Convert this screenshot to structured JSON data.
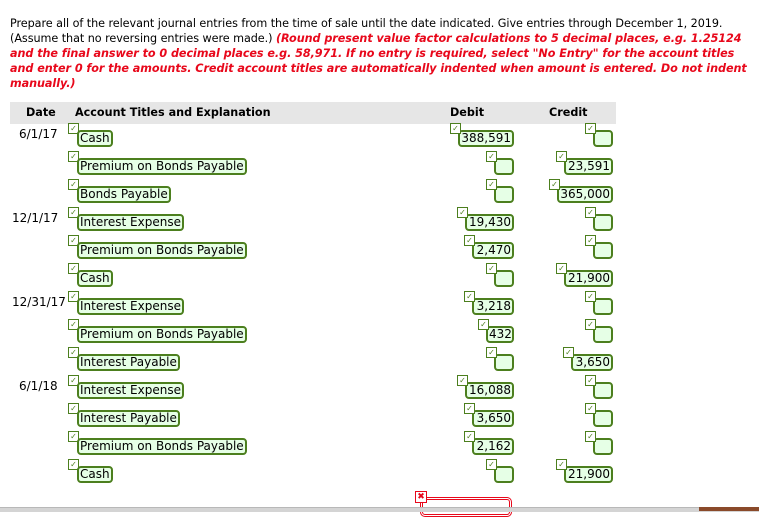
{
  "instructions": {
    "plain": "Prepare all of the relevant journal entries from the time of sale until the date indicated. Give entries through December 1, 2019. (Assume that no reversing entries were made.) ",
    "emphasis": "(Round present value factor calculations to 5 decimal places, e.g. 1.25124 and the final answer to 0 decimal places e.g. 58,971. If no entry is required, select \"No Entry\" for the account titles and enter 0 for the amounts. Credit account titles are automatically indented when amount is entered. Do not indent manually.)"
  },
  "table": {
    "headers": {
      "date": "Date",
      "account": "Account Titles and Explanation",
      "debit": "Debit",
      "credit": "Credit"
    },
    "rows": [
      {
        "date": "6/1/17",
        "account": "Cash",
        "debit": "388,591",
        "credit": ""
      },
      {
        "date": "",
        "account": "Premium on Bonds Payable",
        "debit": "",
        "credit": "23,591"
      },
      {
        "date": "",
        "account": "Bonds Payable",
        "debit": "",
        "credit": "365,000"
      },
      {
        "date": "12/1/17",
        "account": "Interest Expense",
        "debit": "19,430",
        "credit": ""
      },
      {
        "date": "",
        "account": "Premium on Bonds Payable",
        "debit": "2,470",
        "credit": ""
      },
      {
        "date": "",
        "account": "Cash",
        "debit": "",
        "credit": "21,900"
      },
      {
        "date": "12/31/17",
        "account": "Interest Expense",
        "debit": "3,218",
        "credit": ""
      },
      {
        "date": "",
        "account": "Premium on Bonds Payable",
        "debit": "432",
        "credit": ""
      },
      {
        "date": "",
        "account": "Interest Payable",
        "debit": "",
        "credit": "3,650"
      },
      {
        "date": "6/1/18",
        "account": "Interest Expense",
        "debit": "16,088",
        "credit": ""
      },
      {
        "date": "",
        "account": "Interest Payable",
        "debit": "3,650",
        "credit": ""
      },
      {
        "date": "",
        "account": "Premium on Bonds Payable",
        "debit": "2,162",
        "credit": ""
      },
      {
        "date": "",
        "account": "Cash",
        "debit": "",
        "credit": "21,900"
      }
    ],
    "status": {
      "correct_mark": "✓",
      "incorrect_mark": "✖"
    }
  },
  "colors": {
    "correct_border": "#4c7f1e",
    "correct_fill": "#e6ffe6",
    "error": "#e8081b",
    "header_bg": "#e6e6e6"
  }
}
